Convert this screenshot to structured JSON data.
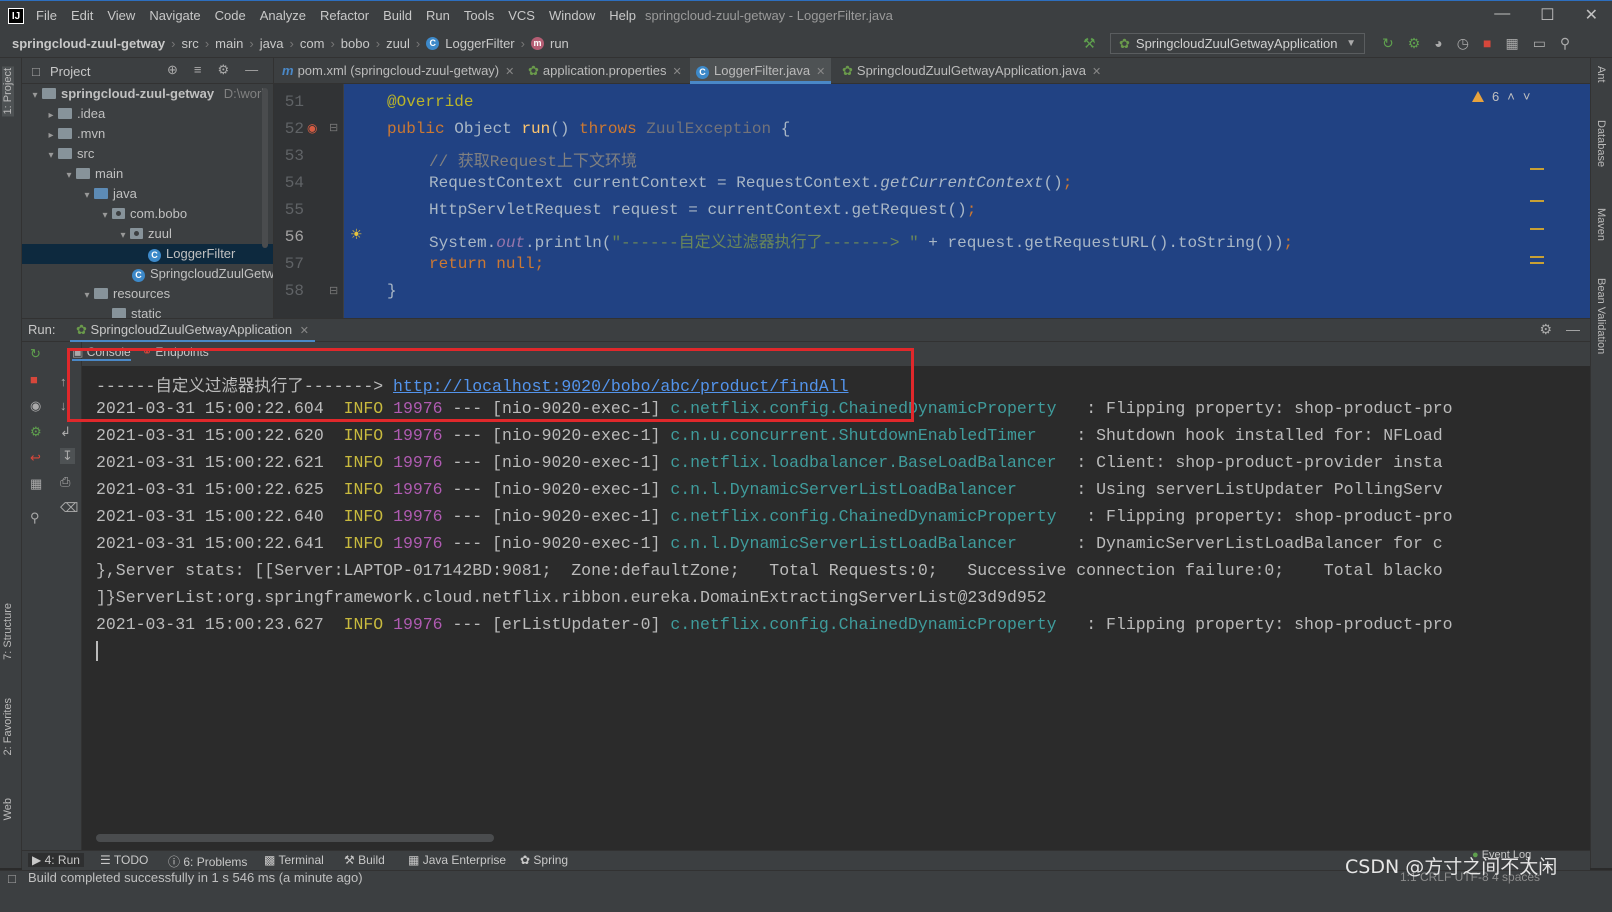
{
  "window": {
    "title": "springcloud-zuul-getway - LoggerFilter.java",
    "menu": [
      "File",
      "Edit",
      "View",
      "Navigate",
      "Code",
      "Analyze",
      "Refactor",
      "Build",
      "Run",
      "Tools",
      "VCS",
      "Window",
      "Help"
    ]
  },
  "breadcrumb": [
    "springcloud-zuul-getway",
    "src",
    "main",
    "java",
    "com",
    "bobo",
    "zuul",
    "LoggerFilter",
    "run"
  ],
  "run_config": "SpringcloudZuulGetwayApplication",
  "left_strip": {
    "project": "1: Project",
    "structure": "7: Structure",
    "favorites": "2: Favorites",
    "web": "Web"
  },
  "right_strip": {
    "ant": "Ant",
    "database": "Database",
    "maven": "Maven",
    "bean": "Bean Validation"
  },
  "project": {
    "title": "Project",
    "tree": [
      {
        "label": "springcloud-zuul-getway",
        "extra": "D:\\work"
      },
      {
        "label": ".idea"
      },
      {
        "label": ".mvn"
      },
      {
        "label": "src"
      },
      {
        "label": "main"
      },
      {
        "label": "java"
      },
      {
        "label": "com.bobo"
      },
      {
        "label": "zuul"
      },
      {
        "label": "LoggerFilter"
      },
      {
        "label": "SpringcloudZuulGetw"
      },
      {
        "label": "resources"
      },
      {
        "label": "static"
      }
    ]
  },
  "editor_tabs": [
    "pom.xml (springcloud-zuul-getway)",
    "application.properties",
    "LoggerFilter.java",
    "SpringcloudZuulGetwayApplication.java"
  ],
  "editor": {
    "warnings": "6",
    "line_numbers": [
      "51",
      "52",
      "53",
      "54",
      "55",
      "56",
      "57",
      "58"
    ],
    "lines": {
      "l51": "@Override",
      "l52_kw1": "public ",
      "l52_type": "Object ",
      "l52_name": "run",
      "l52_paren": "() ",
      "l52_kw2": "throws ",
      "l52_exc": "ZuulException",
      "l52_end": " {",
      "l53": "// 获取Request上下文环境",
      "l54_a": "RequestContext currentContext = RequestContext.",
      "l54_b": "getCurrentContext",
      "l54_c": "()",
      "l54_d": ";",
      "l55_a": "HttpServletRequest request = currentContext.getRequest()",
      "l55_b": ";",
      "l56_a": "System.",
      "l56_b": "out",
      "l56_c": ".println(",
      "l56_d": "\"------自定义过滤器执行了-------> \"",
      "l56_e": " + request.getRequestURL().toString())",
      "l56_f": ";",
      "l57_a": "return null",
      "l57_b": ";",
      "l58": "}"
    }
  },
  "run": {
    "label": "Run:",
    "tab": "SpringcloudZuulGetwayApplication",
    "subtabs": [
      "Console",
      "Endpoints"
    ]
  },
  "console": {
    "first_prefix": "------自定义过滤器执行了-------> ",
    "first_link": "http://localhost:9020/bobo/abc/product/findAll",
    "logs": [
      {
        "ts": "2021-03-31 15:00:22.604",
        "level": "INFO",
        "pid": "19976",
        "thread": " --- [nio-9020-exec-1] ",
        "logger": "c.netflix.config.ChainedDynamicProperty  ",
        "msg": " : Flipping property: shop-product-pro"
      },
      {
        "ts": "2021-03-31 15:00:22.620",
        "level": "INFO",
        "pid": "19976",
        "thread": " --- [nio-9020-exec-1] ",
        "logger": "c.n.u.concurrent.ShutdownEnabledTimer   ",
        "msg": " : Shutdown hook installed for: NFLoad"
      },
      {
        "ts": "2021-03-31 15:00:22.621",
        "level": "INFO",
        "pid": "19976",
        "thread": " --- [nio-9020-exec-1] ",
        "logger": "c.netflix.loadbalancer.BaseLoadBalancer ",
        "msg": " : Client: shop-product-provider insta"
      },
      {
        "ts": "2021-03-31 15:00:22.625",
        "level": "INFO",
        "pid": "19976",
        "thread": " --- [nio-9020-exec-1] ",
        "logger": "c.n.l.DynamicServerListLoadBalancer     ",
        "msg": " : Using serverListUpdater PollingServ"
      },
      {
        "ts": "2021-03-31 15:00:22.640",
        "level": "INFO",
        "pid": "19976",
        "thread": " --- [nio-9020-exec-1] ",
        "logger": "c.netflix.config.ChainedDynamicProperty  ",
        "msg": " : Flipping property: shop-product-pro"
      },
      {
        "ts": "2021-03-31 15:00:22.641",
        "level": "INFO",
        "pid": "19976",
        "thread": " --- [nio-9020-exec-1] ",
        "logger": "c.n.l.DynamicServerListLoadBalancer     ",
        "msg": " : DynamicServerListLoadBalancer for c"
      }
    ],
    "plain1": "},Server stats: [[Server:LAPTOP-017142BD:9081;  Zone:defaultZone;   Total Requests:0;   Successive connection failure:0;    Total blacko",
    "plain2": "]}ServerList:org.springframework.cloud.netflix.ribbon.eureka.DomainExtractingServerList@23d9d952",
    "last": {
      "ts": "2021-03-31 15:00:23.627",
      "level": "INFO",
      "pid": "19976",
      "thread": " --- [erListUpdater-0] ",
      "logger": "c.netflix.config.ChainedDynamicProperty  ",
      "msg": " : Flipping property: shop-product-pro"
    }
  },
  "bottom_tabs": [
    "4: Run",
    "TODO",
    "6: Problems",
    "Terminal",
    "Build",
    "Java Enterprise",
    "Spring"
  ],
  "event_log": "Event Log",
  "status": {
    "text": "Build completed successfully in 1 s 546 ms (a minute ago)",
    "right": "1:1  CRLF  UTF-8  4 spaces"
  },
  "watermark": "CSDN @方寸之间不太闲",
  "colors": {
    "selection": "#214283",
    "highlight_box": "#e0282b",
    "accent": "#4a88c7"
  }
}
